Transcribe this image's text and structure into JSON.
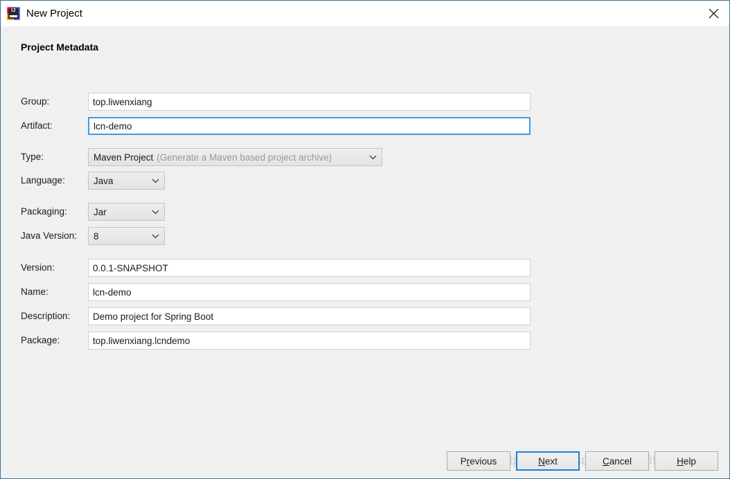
{
  "window": {
    "title": "New Project",
    "app_icon": "intellij-idea-icon",
    "icon_letters": "IJ",
    "close_icon": "close-icon",
    "border_color": "#3a6f8f"
  },
  "section": {
    "title": "Project Metadata"
  },
  "fields": {
    "group": {
      "label": "Group:",
      "value": "top.liwenxiang"
    },
    "artifact": {
      "label": "Artifact:",
      "value": "lcn-demo"
    },
    "type": {
      "label": "Type:",
      "value": "Maven Project",
      "hint": "(Generate a Maven based project archive)"
    },
    "language": {
      "label": "Language:",
      "value": "Java"
    },
    "packaging": {
      "label": "Packaging:",
      "value": "Jar"
    },
    "javaversion": {
      "label": "Java Version:",
      "value": "8"
    },
    "version": {
      "label": "Version:",
      "value": "0.0.1-SNAPSHOT"
    },
    "name": {
      "label": "Name:",
      "value": "lcn-demo"
    },
    "description": {
      "label": "Description:",
      "value": "Demo project for Spring Boot"
    },
    "package": {
      "label": "Package:",
      "value": "top.liwenxiang.lcndemo"
    }
  },
  "buttons": {
    "previous": {
      "before": "P",
      "mnemonic": "r",
      "after": "evious"
    },
    "next": {
      "before": "",
      "mnemonic": "N",
      "after": "ext"
    },
    "cancel": {
      "before": "",
      "mnemonic": "C",
      "after": "ancel"
    },
    "help": {
      "before": "",
      "mnemonic": "H",
      "after": "elp"
    }
  },
  "watermark": {
    "text": "https://blog.csdn.net/qq_39087639"
  },
  "colors": {
    "focus_blue": "#3d9ae0",
    "button_focus_blue": "#1f7fd4",
    "dialog_bg": "#f0f0f0"
  }
}
